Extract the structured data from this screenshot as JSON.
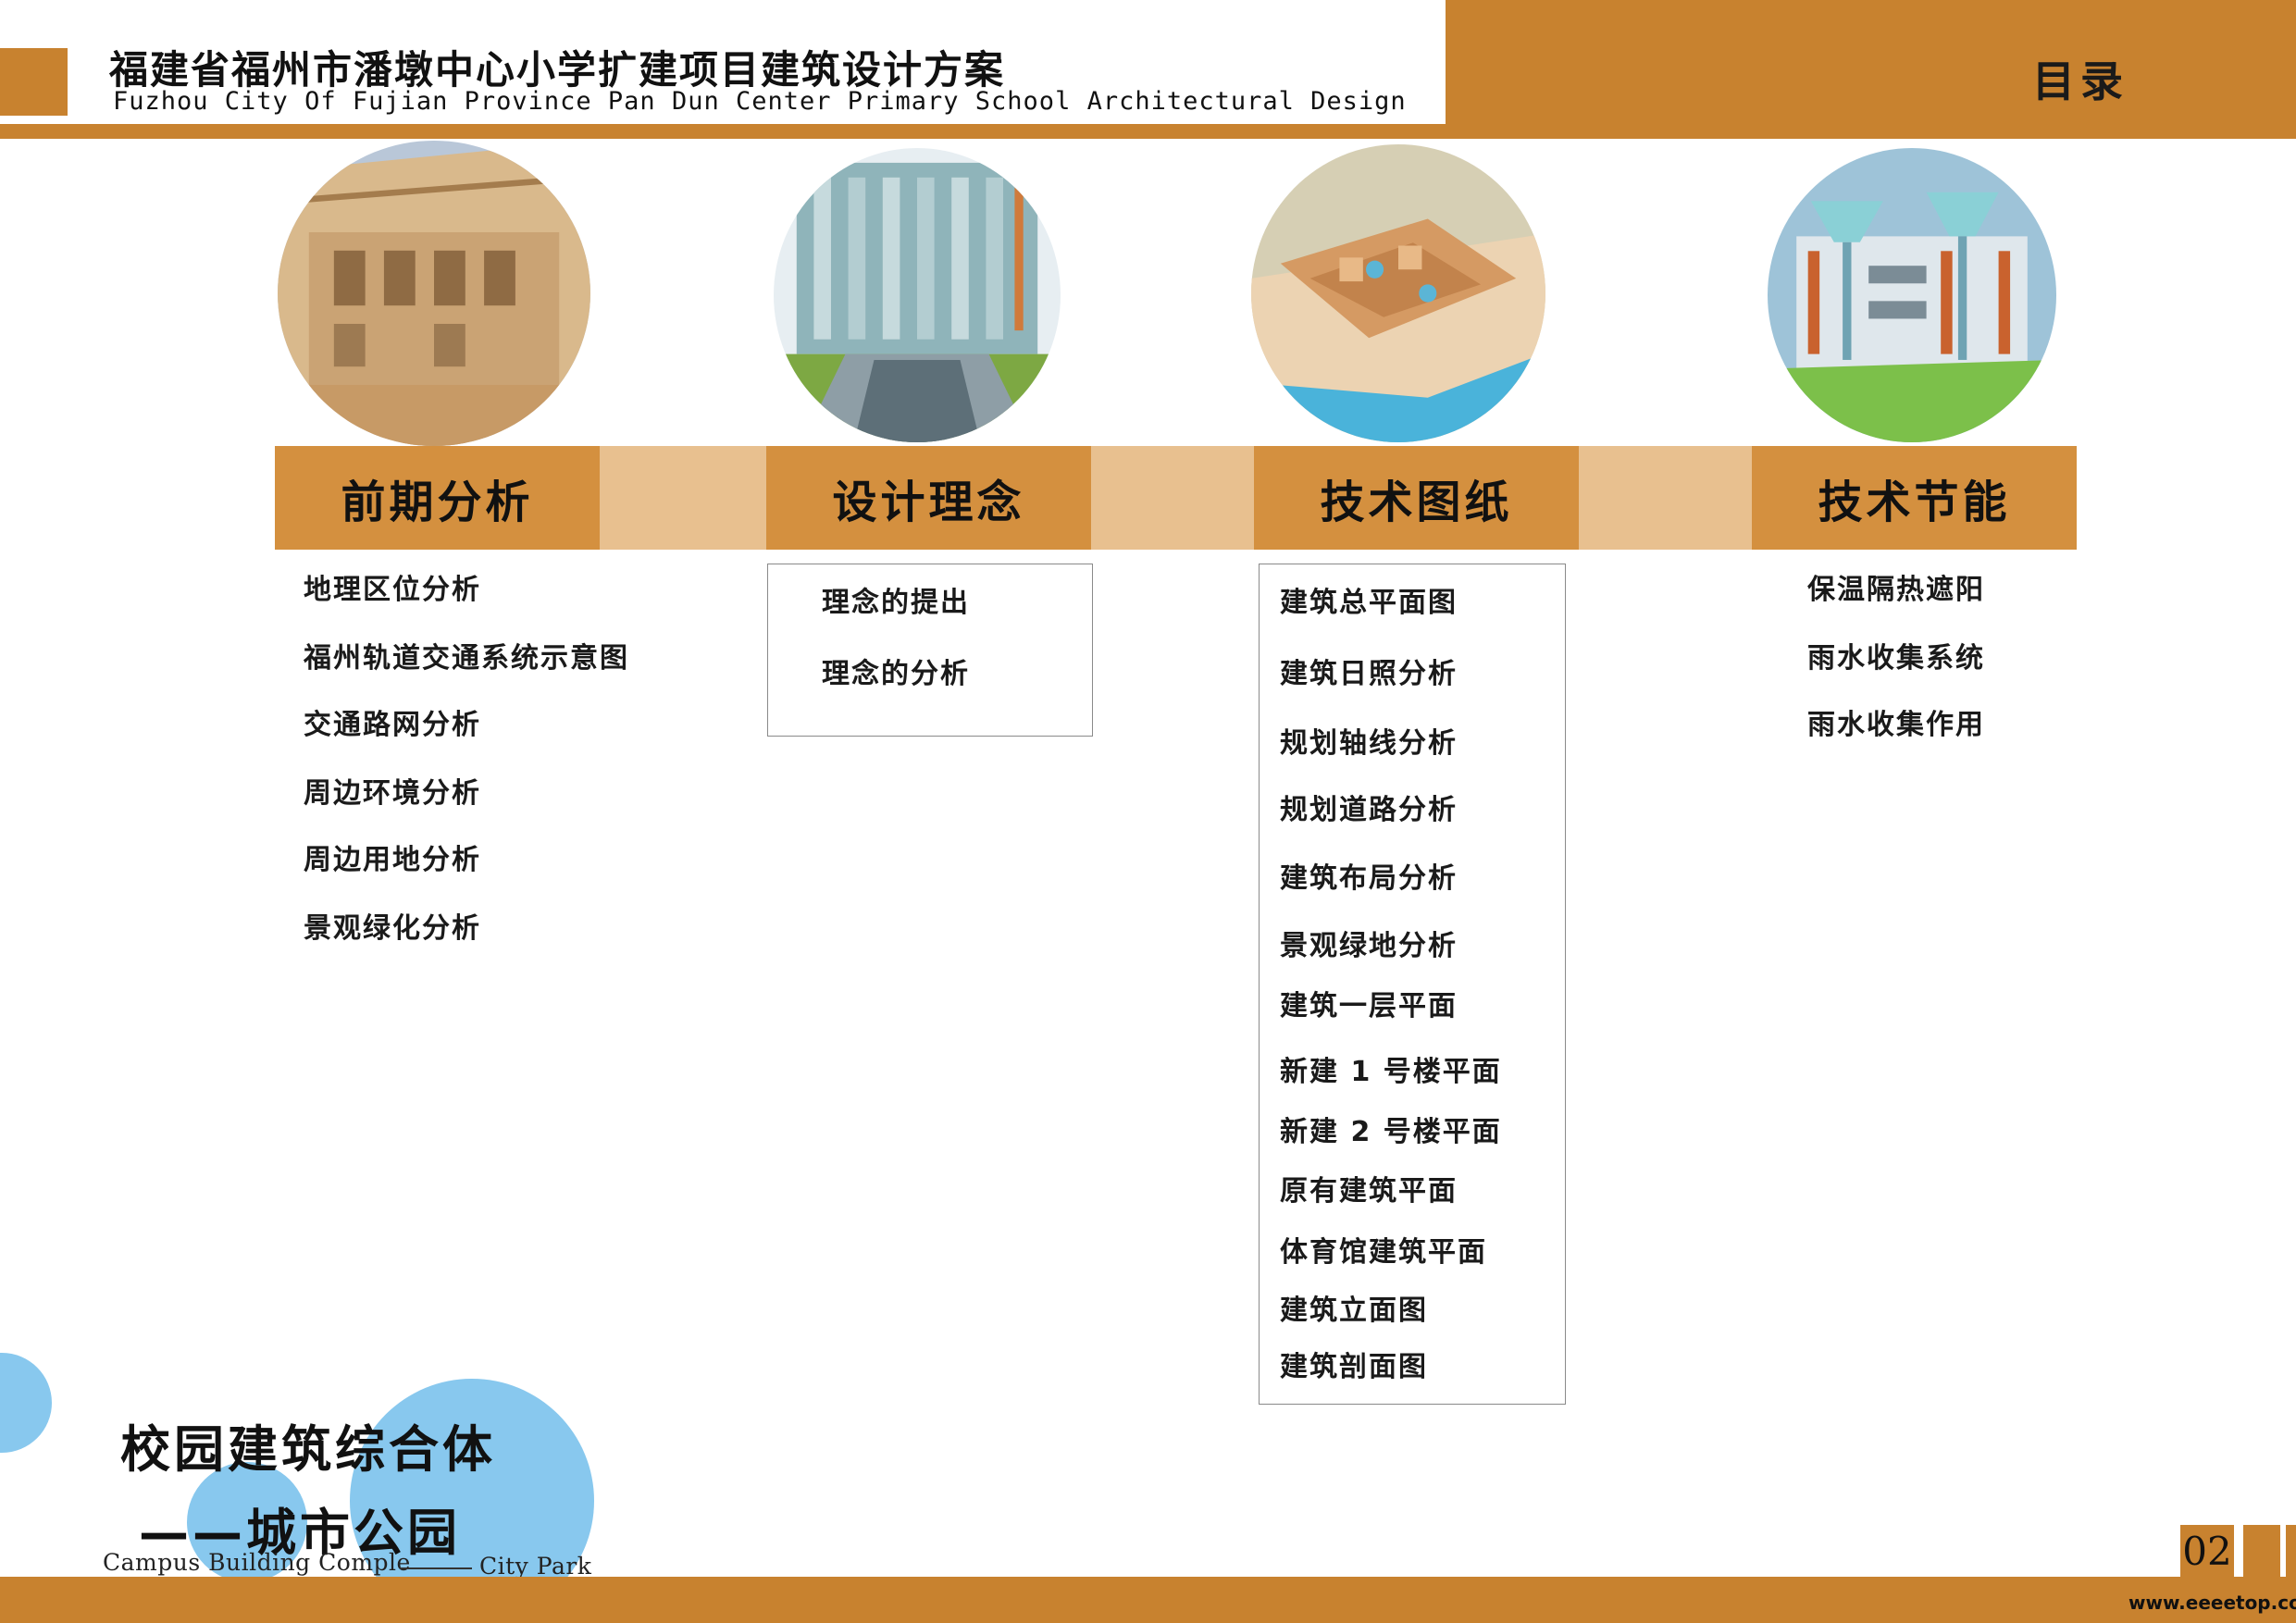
{
  "header": {
    "title_cn": "福建省福州市潘墩中心小学扩建项目建筑设计方案",
    "title_en": "Fuzhou City Of Fujian Province Pan Dun Center Primary School Architectural Design",
    "toc_label": "目录"
  },
  "sections": [
    {
      "title": "前期分析",
      "items": [
        "地理区位分析",
        "福州轨道交通系统示意图",
        "交通路网分析",
        "周边环境分析",
        "周边用地分析",
        "景观绿化分析"
      ]
    },
    {
      "title": "设计理念",
      "items": [
        "理念的提出",
        "理念的分析"
      ]
    },
    {
      "title": "技术图纸",
      "items": [
        "建筑总平面图",
        "建筑日照分析",
        "规划轴线分析",
        "规划道路分析",
        "建筑布局分析",
        "景观绿地分析",
        "建筑一层平面",
        "新建 1 号楼平面",
        "新建 2 号楼平面",
        "原有建筑平面",
        "体育馆建筑平面",
        "建筑立面图",
        "建筑剖面图"
      ]
    },
    {
      "title": "技术节能",
      "items": [
        "保温隔热遮阳",
        "雨水收集系统",
        "雨水收集作用"
      ]
    }
  ],
  "slogan": {
    "line1": "校园建筑综合体",
    "line2": "——城市公园",
    "en_left": "Campus Building Comple",
    "en_right": "City Park"
  },
  "page_number": "02",
  "watermark": "www.eeeetop.com",
  "colors": {
    "accent_orange": "#c8822f",
    "section_box": "#d4903f",
    "section_bar_light": "#e8c08f",
    "bubble_blue": "#88c8ee"
  }
}
